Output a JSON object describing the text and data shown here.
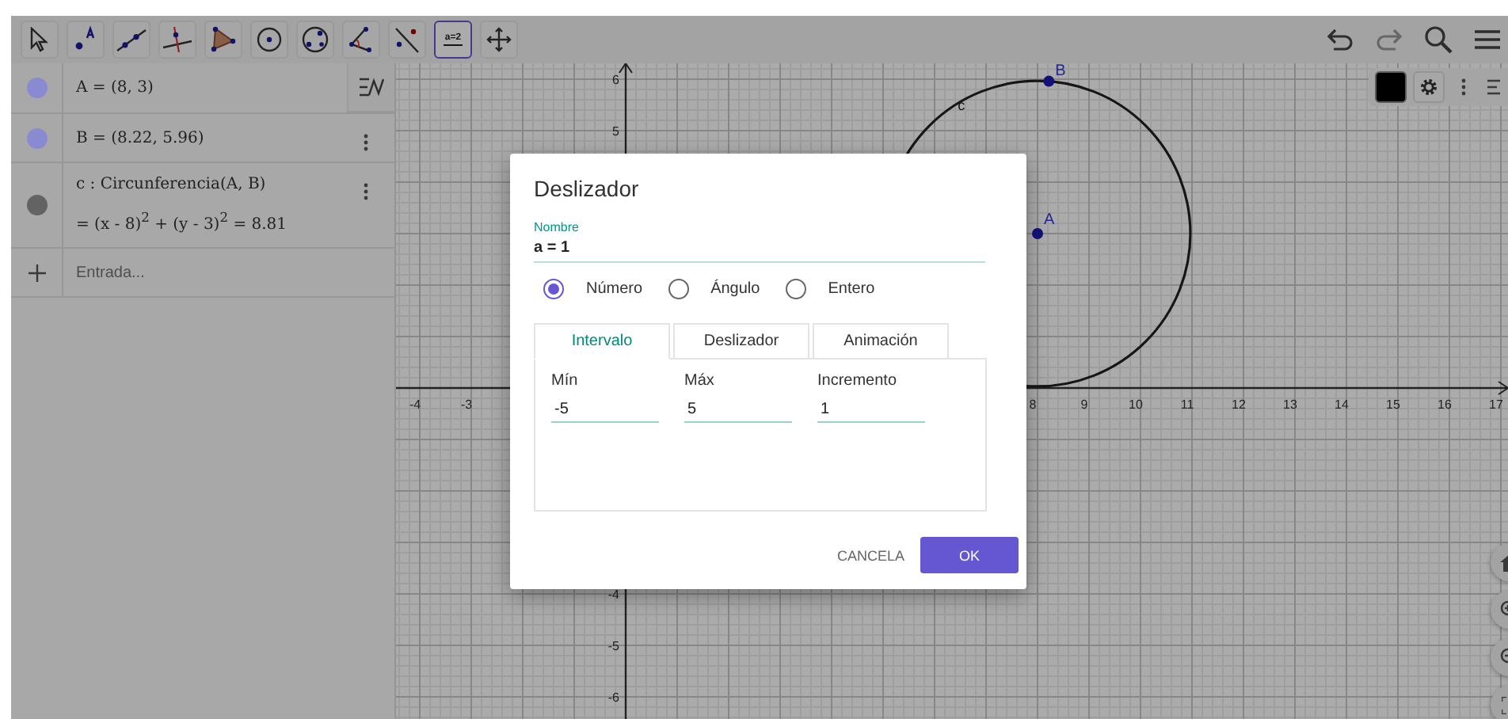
{
  "toolbar": {
    "tools": [
      {
        "kind": "pointer",
        "selected": false
      },
      {
        "kind": "point",
        "selected": false
      },
      {
        "kind": "line",
        "selected": false
      },
      {
        "kind": "perpendicular",
        "selected": false
      },
      {
        "kind": "polygon",
        "selected": false
      },
      {
        "kind": "circle",
        "selected": false
      },
      {
        "kind": "circle3",
        "selected": false
      },
      {
        "kind": "angle",
        "selected": false
      },
      {
        "kind": "reflect",
        "selected": false
      },
      {
        "kind": "slider",
        "selected": true,
        "text": "a=2"
      },
      {
        "kind": "move",
        "selected": false
      }
    ]
  },
  "top_actions": [
    {
      "kind": "undo",
      "disabled": false
    },
    {
      "kind": "redo",
      "disabled": true
    },
    {
      "kind": "search"
    },
    {
      "kind": "menu"
    }
  ],
  "algebra": {
    "items": [
      {
        "kind": "object",
        "color": "#8a8ad2",
        "lines": [
          "A = (8, 3)"
        ],
        "menu": false
      },
      {
        "kind": "object",
        "color": "#8a8ad2",
        "lines": [
          "B = (8.22, 5.96)"
        ],
        "menu": true
      },
      {
        "kind": "object",
        "color": "#636363",
        "lines": [
          "c : Circunferencia(A, B)",
          "= (x - 8)$^{2}$ + (y - 3)$^{2}$ = 8.81"
        ],
        "menu": true
      },
      {
        "kind": "input",
        "placeholder": "Entrada..."
      }
    ]
  },
  "graphics": {
    "style_bar": {
      "color": "#000000"
    },
    "x_labels": [
      "-4",
      "-3",
      "8",
      "9",
      "10",
      "11",
      "12",
      "13",
      "14",
      "15",
      "16",
      "17"
    ],
    "y_labels": [
      "6",
      "5",
      "-4",
      "-5",
      "-6"
    ],
    "points": [
      {
        "label": "A"
      },
      {
        "label": "B"
      }
    ],
    "curves": [
      {
        "label": "c"
      }
    ],
    "nav": [
      {
        "kind": "home"
      },
      {
        "kind": "zoom_in"
      },
      {
        "kind": "zoom_out"
      },
      {
        "kind": "fullscreen"
      }
    ]
  },
  "dialog": {
    "title": "Deslizador",
    "name_field": {
      "label": "Nombre",
      "value": "a = 1"
    },
    "types": [
      {
        "label": "Número",
        "selected": true
      },
      {
        "label": "Ángulo",
        "selected": false
      },
      {
        "label": "Entero",
        "selected": false
      }
    ],
    "tabs": [
      {
        "label": "Intervalo",
        "selected": true
      },
      {
        "label": "Deslizador",
        "selected": false
      },
      {
        "label": "Animación",
        "selected": false
      }
    ],
    "fields": [
      {
        "label": "Mín",
        "value": "-5"
      },
      {
        "label": "Máx",
        "value": "5"
      },
      {
        "label": "Incremento",
        "value": "1"
      }
    ],
    "buttons": [
      {
        "kind": "text",
        "label": "CANCELA"
      },
      {
        "kind": "primary",
        "label": "OK"
      }
    ]
  }
}
